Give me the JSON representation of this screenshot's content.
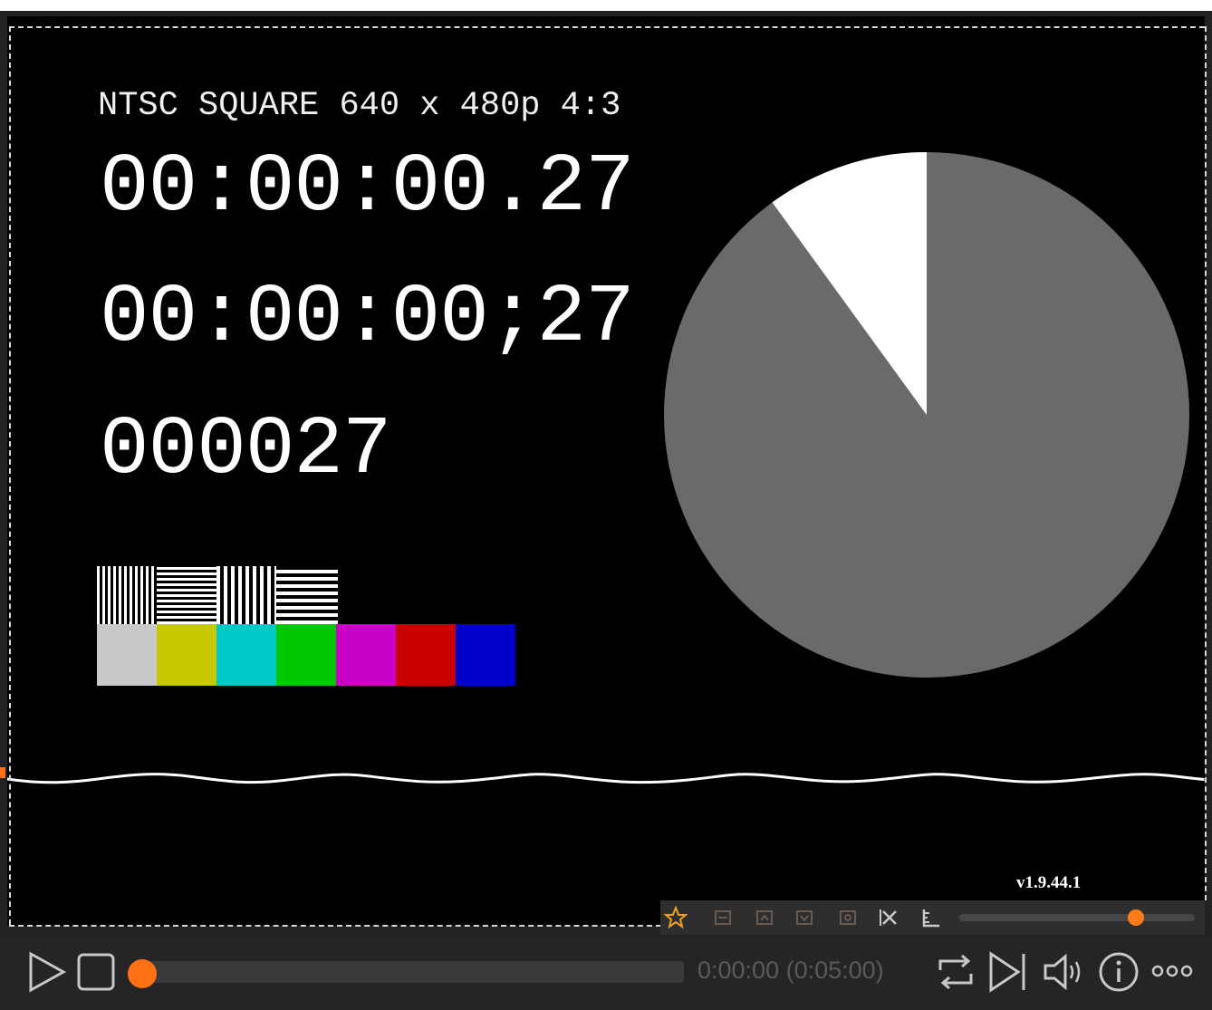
{
  "overlay": {
    "title_line": "NTSC SQUARE 640 x 480p 4:3",
    "timecode_dot": "00:00:00.27",
    "timecode_semicolon": "00:00:00;27",
    "frame_number": "000027",
    "version": "v1.9.44.1"
  },
  "pie_progress": {
    "elapsed_fraction": 0.9,
    "colors": {
      "main": "#6a6a6a",
      "remaining": "#ffffff"
    }
  },
  "color_bars": [
    "#c8c8c8",
    "#c8c800",
    "#00c8c8",
    "#00c800",
    "#c800c8",
    "#c80000",
    "#0000c8"
  ],
  "toolbar": {
    "icons": [
      "star-icon",
      "frame-icon-1",
      "frame-icon-2",
      "frame-icon-3",
      "frame-icon-4",
      "crop-x-icon",
      "ruler-icon"
    ],
    "zoom_level": 0.75
  },
  "controls": {
    "time_display": "0:00:00 (0:05:00)",
    "seek_progress": 0.0,
    "accent": "#ff7114"
  }
}
